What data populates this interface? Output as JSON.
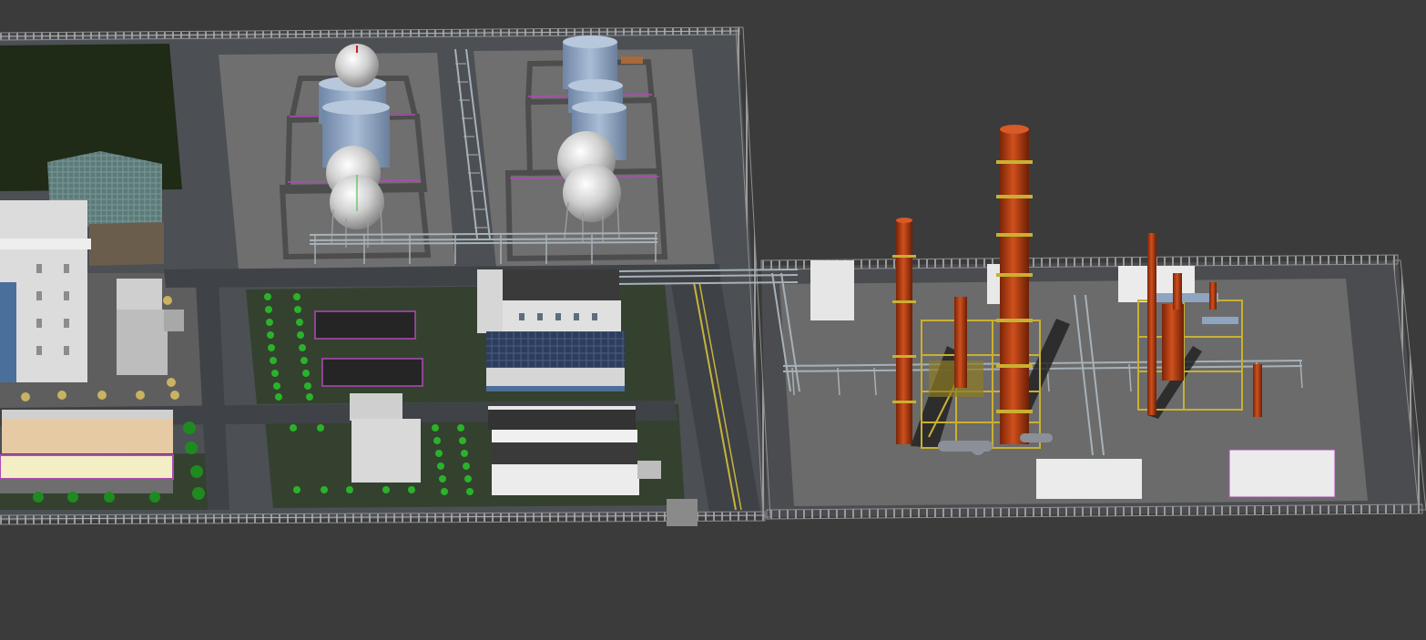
{
  "scene": {
    "colors": {
      "background": "#3b3b3b",
      "ground": "#6a6a6a",
      "road": "#4a4d52",
      "grass": "#35432f",
      "field_dark": "#1f2a17",
      "tank": "#8fa4bf",
      "sphere": "#d4d4d4",
      "column": "#b33a12",
      "steel": "#c9b032",
      "pipe": "#a7b1b8",
      "tree": "#2bb22b",
      "building": "#d9d9d9",
      "roof": "#333333",
      "highlight": "#b04ab5"
    },
    "icons": [
      "storage-tank",
      "spherical-tank",
      "distillation-column",
      "pipe-rack",
      "fence",
      "tree",
      "building"
    ]
  }
}
